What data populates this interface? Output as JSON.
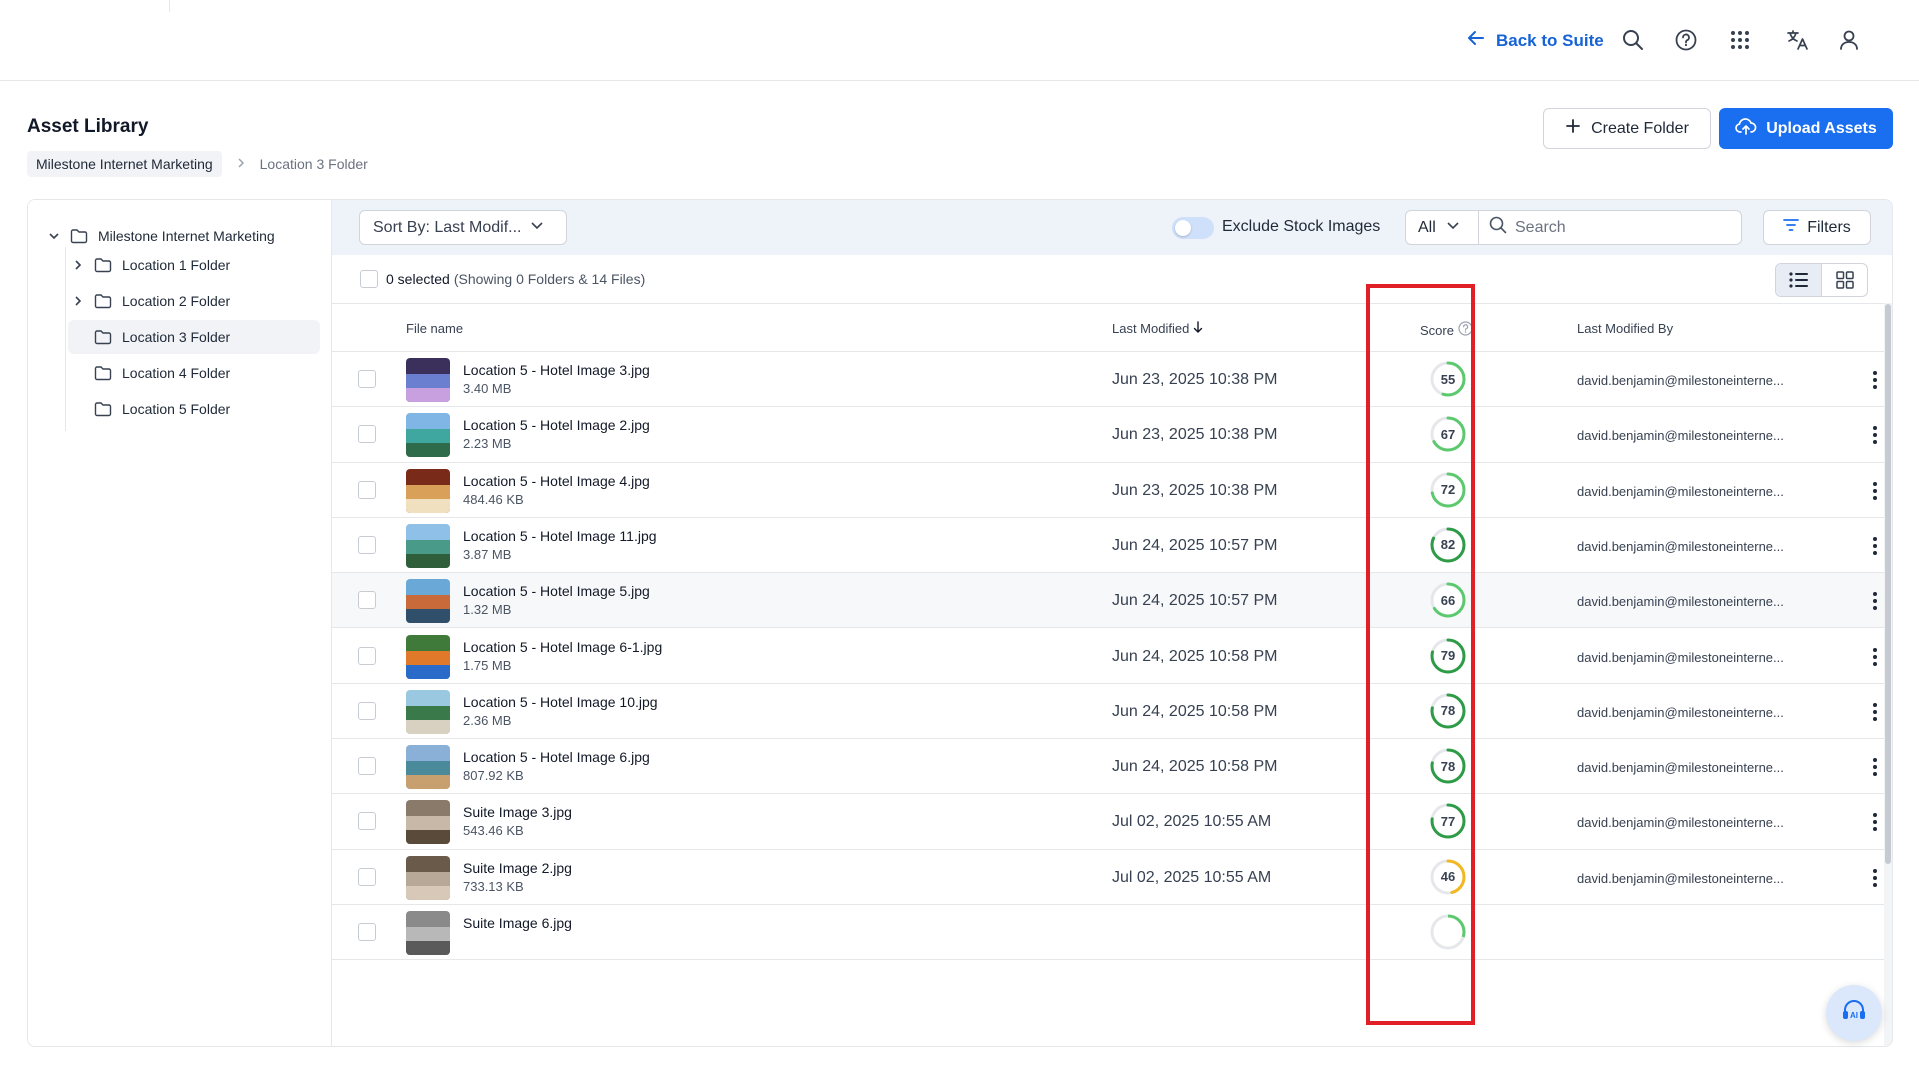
{
  "header": {
    "back_label": "Back to Suite",
    "icons": [
      "search-icon",
      "help-icon",
      "apps-grid-icon",
      "translate-icon",
      "user-icon"
    ]
  },
  "page": {
    "title": "Asset Library",
    "breadcrumb": {
      "root": "Milestone Internet Marketing",
      "current": "Location 3 Folder"
    },
    "create_folder_label": "Create Folder",
    "upload_label": "Upload Assets"
  },
  "sidebar": {
    "root": "Milestone Internet Marketing",
    "items": [
      {
        "label": "Location 1 Folder",
        "expandable": true
      },
      {
        "label": "Location 2 Folder",
        "expandable": true
      },
      {
        "label": "Location 3 Folder",
        "expandable": false,
        "active": true
      },
      {
        "label": "Location 4 Folder",
        "expandable": false
      },
      {
        "label": "Location 5 Folder",
        "expandable": false
      }
    ]
  },
  "toolbar": {
    "sort_label": "Sort By: Last Modif...",
    "exclude_stock_label": "Exclude Stock Images",
    "exclude_stock_on": false,
    "type_filter": "All",
    "search_placeholder": "Search",
    "filters_label": "Filters"
  },
  "selection": {
    "count_label": "0 selected",
    "summary": "(Showing 0 Folders & 14 Files)"
  },
  "table": {
    "columns": {
      "name": "File name",
      "modified": "Last Modified",
      "score": "Score",
      "by": "Last Modified By"
    },
    "rows": [
      {
        "name": "Location 5 - Hotel Image 3.jpg",
        "size": "3.40 MB",
        "modified": "Jun 23, 2025 10:38 PM",
        "score": 55,
        "by": "david.benjamin@milestoneinterne..."
      },
      {
        "name": "Location 5 - Hotel Image 2.jpg",
        "size": "2.23 MB",
        "modified": "Jun 23, 2025 10:38 PM",
        "score": 67,
        "by": "david.benjamin@milestoneinterne..."
      },
      {
        "name": "Location 5 - Hotel Image 4.jpg",
        "size": "484.46 KB",
        "modified": "Jun 23, 2025 10:38 PM",
        "score": 72,
        "by": "david.benjamin@milestoneinterne..."
      },
      {
        "name": "Location 5 - Hotel Image 11.jpg",
        "size": "3.87 MB",
        "modified": "Jun 24, 2025 10:57 PM",
        "score": 82,
        "by": "david.benjamin@milestoneinterne..."
      },
      {
        "name": "Location 5 - Hotel Image 5.jpg",
        "size": "1.32 MB",
        "modified": "Jun 24, 2025 10:57 PM",
        "score": 66,
        "by": "david.benjamin@milestoneinterne..."
      },
      {
        "name": "Location 5 - Hotel Image 6-1.jpg",
        "size": "1.75 MB",
        "modified": "Jun 24, 2025 10:58 PM",
        "score": 79,
        "by": "david.benjamin@milestoneinterne..."
      },
      {
        "name": "Location 5 - Hotel Image 10.jpg",
        "size": "2.36 MB",
        "modified": "Jun 24, 2025 10:58 PM",
        "score": 78,
        "by": "david.benjamin@milestoneinterne..."
      },
      {
        "name": "Location 5 - Hotel Image 6.jpg",
        "size": "807.92 KB",
        "modified": "Jun 24, 2025 10:58 PM",
        "score": 78,
        "by": "david.benjamin@milestoneinterne..."
      },
      {
        "name": "Suite Image 3.jpg",
        "size": "543.46 KB",
        "modified": "Jul 02, 2025 10:55 AM",
        "score": 77,
        "by": "david.benjamin@milestoneinterne..."
      },
      {
        "name": "Suite Image 2.jpg",
        "size": "733.13 KB",
        "modified": "Jul 02, 2025 10:55 AM",
        "score": 46,
        "by": "david.benjamin@milestoneinterne..."
      },
      {
        "name": "Suite Image 6.jpg",
        "size": "",
        "modified": "",
        "score": null,
        "by": ""
      }
    ]
  },
  "colors": {
    "accent": "#1a6ff1",
    "highlight": "#e01f26",
    "score_high": "#2e9b47",
    "score_mid": "#5cc96f",
    "score_low": "#f2b822"
  }
}
